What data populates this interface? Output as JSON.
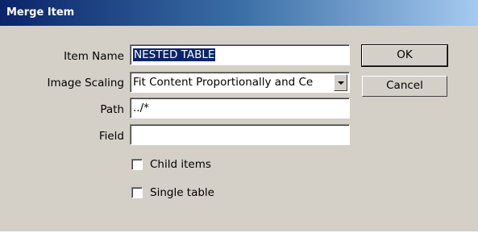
{
  "window": {
    "title": "Merge Item"
  },
  "form": {
    "item_name": {
      "label": "Item Name",
      "value": "NESTED TABLE"
    },
    "image_scaling": {
      "label": "Image Scaling",
      "value": "Fit Content Proportionally and Ce"
    },
    "path": {
      "label": "Path",
      "value": "../*"
    },
    "field": {
      "label": "Field",
      "value": ""
    }
  },
  "options": {
    "child_items": {
      "label": "Child items",
      "checked": false
    },
    "single_table": {
      "label": "Single table",
      "checked": false
    }
  },
  "buttons": {
    "ok": "OK",
    "cancel": "Cancel"
  },
  "colors": {
    "dialog_bg": "#d4d0c8",
    "title_gradient_start": "#0a246a",
    "title_gradient_end": "#a6caf0",
    "selection": "#0a246a"
  },
  "icons": {
    "dropdown": "chevron-down-icon"
  }
}
